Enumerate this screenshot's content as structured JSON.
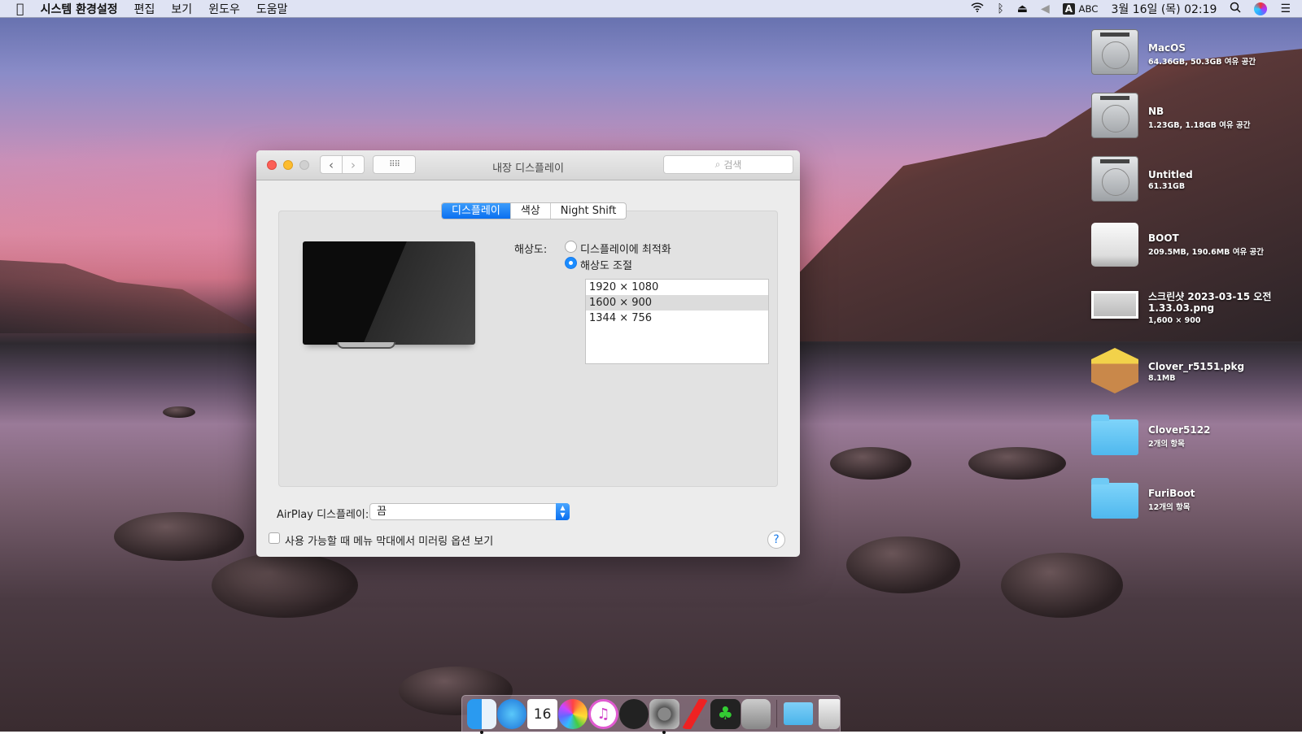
{
  "menubar": {
    "app": "시스템 환경설정",
    "items": [
      "편집",
      "보기",
      "윈도우",
      "도움말"
    ],
    "status": {
      "input_badge": "A",
      "input_name": "ABC",
      "datetime": "3월 16일 (목)  02:19"
    },
    "icons": [
      "apple-icon",
      "wifi-icon",
      "bluetooth-icon",
      "eject-icon",
      "volume-icon",
      "search-icon",
      "siri-icon",
      "notification-list-icon"
    ]
  },
  "window": {
    "title": "내장 디스플레이",
    "search_placeholder": "검색",
    "tabs": [
      {
        "label": "디스플레이",
        "active": true
      },
      {
        "label": "색상",
        "active": false
      },
      {
        "label": "Night Shift",
        "active": false
      }
    ],
    "resolution_label": "해상도:",
    "options": [
      {
        "label": "디스플레이에 최적화",
        "selected": false
      },
      {
        "label": "해상도 조절",
        "selected": true
      }
    ],
    "resolutions": [
      "1920 × 1080",
      "1600 × 900",
      "1344 × 756"
    ],
    "selected_resolution": "1600 × 900",
    "airplay_label": "AirPlay 디스플레이:",
    "airplay_value": "끔",
    "mirror_checkbox": {
      "label": "사용 가능할 때 메뉴 막대에서 미러링 옵션 보기",
      "checked": false
    },
    "help": "?"
  },
  "desktop_icons": [
    {
      "name": "MacOS",
      "sub": "64.36GB, 50.3GB 여유 공간",
      "type": "hdd"
    },
    {
      "name": "NB",
      "sub": "1.23GB, 1.18GB 여유 공간",
      "type": "hdd"
    },
    {
      "name": "Untitled",
      "sub": "61.31GB",
      "type": "hdd"
    },
    {
      "name": "BOOT",
      "sub": "209.5MB, 190.6MB 여유 공간",
      "type": "external"
    },
    {
      "name": "스크린샷 2023-03-15 오전",
      "name2": "1.33.03.png",
      "sub": "1,600 × 900",
      "type": "image"
    },
    {
      "name": "Clover_r5151.pkg",
      "sub": "8.1MB",
      "type": "package"
    },
    {
      "name": "Clover5122",
      "sub": "2개의 항목",
      "type": "folder"
    },
    {
      "name": "FuriBoot",
      "sub": "12개의 항목",
      "type": "folder"
    }
  ],
  "dock": {
    "apps": [
      "finder",
      "safari",
      "calendar",
      "photos",
      "itunes",
      "dashboard",
      "system-preferences",
      "clover-configurator",
      "clover",
      "disk-utility"
    ],
    "calendar": {
      "month": "3월",
      "day": "16"
    },
    "running": [
      "finder",
      "system-preferences"
    ],
    "stacks": [
      "downloads",
      "trash"
    ]
  },
  "colors": {
    "accent": "#0a6ff0"
  }
}
